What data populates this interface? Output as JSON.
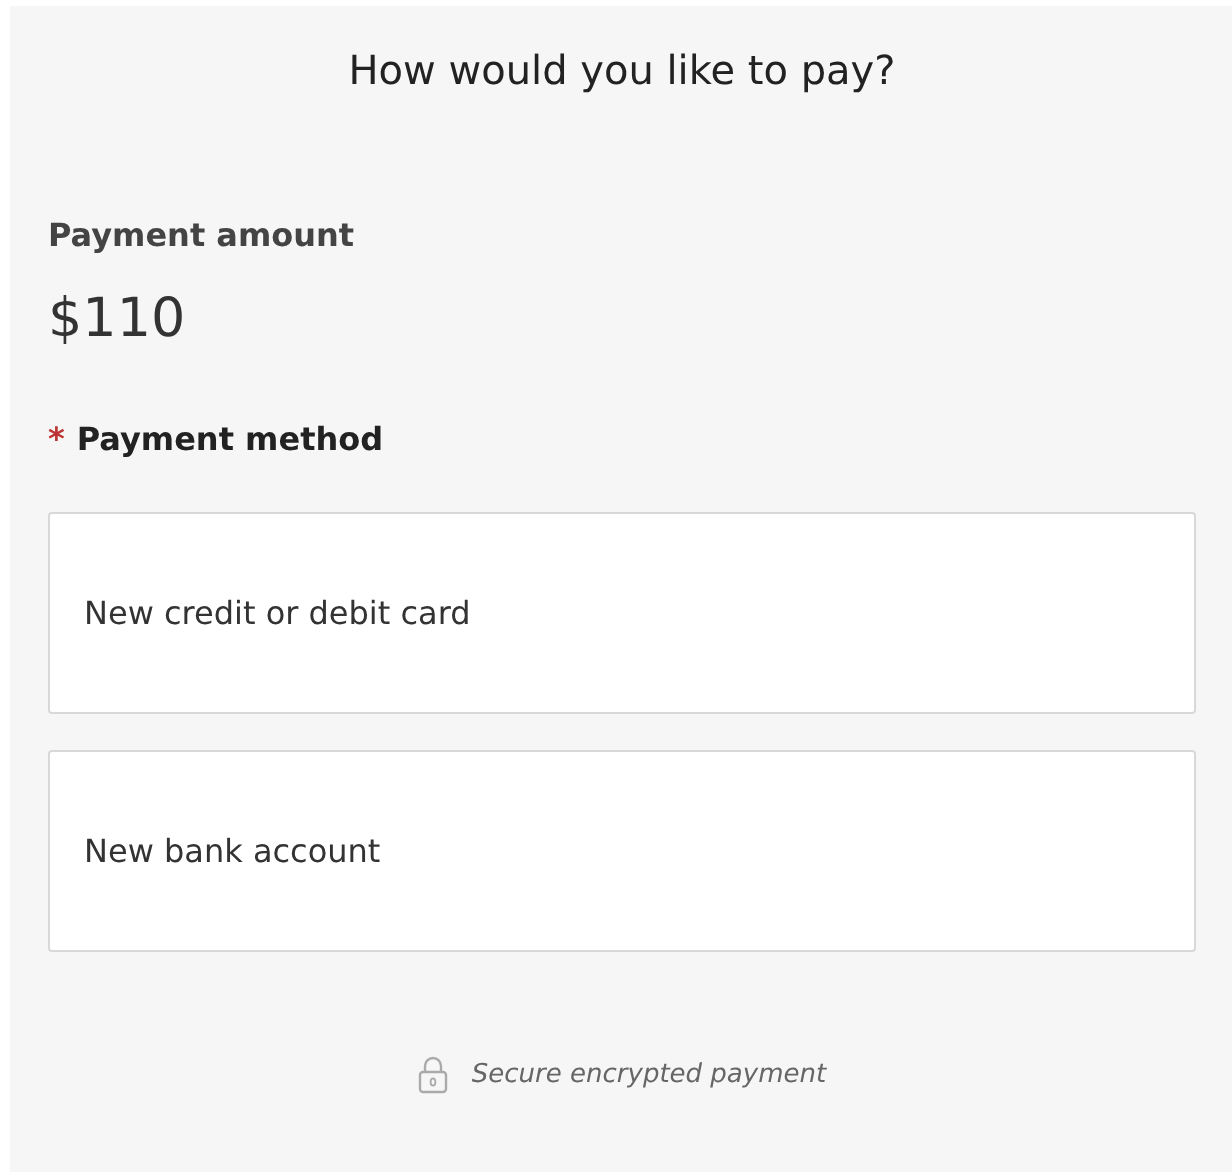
{
  "title": "How would you like to pay?",
  "amount": {
    "label": "Payment amount",
    "value": "$110"
  },
  "method": {
    "label": "Payment method",
    "required_mark": "*",
    "options": [
      {
        "label": "New credit or debit card"
      },
      {
        "label": "New bank account"
      }
    ]
  },
  "footer": {
    "text": "Secure encrypted payment"
  }
}
